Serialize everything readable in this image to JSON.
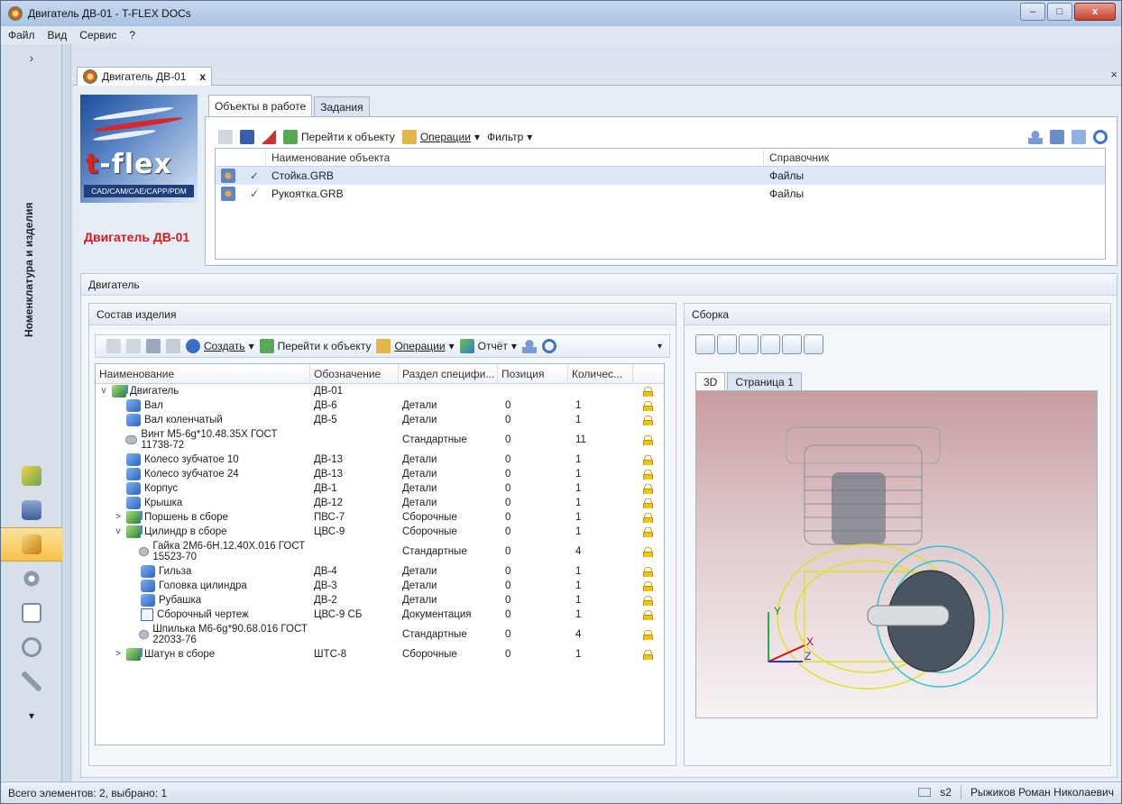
{
  "window": {
    "title": "Двигатель ДВ-01 - T-FLEX DOCs",
    "minimize": "–",
    "maximize": "□",
    "close": "x"
  },
  "menu": [
    "Файл",
    "Вид",
    "Сервис",
    "?"
  ],
  "left_panel": {
    "expander": "›",
    "section_label": "Номенклатура и изделия",
    "more": "▾"
  },
  "doc_tab": {
    "label": "Двигатель ДВ-01",
    "close": "x",
    "close_all": "×"
  },
  "logo": {
    "brand_t": "t",
    "brand_rest": "-flex",
    "subtitle": "CAD/CAM/CAE/CAPP/PDM"
  },
  "product_name": "Двигатель ДВ-01",
  "work_panel": {
    "tabs": [
      "Объекты в работе",
      "Задания"
    ],
    "toolbar": {
      "goto": "Перейти к объекту",
      "operations": "Операции",
      "filter": "Фильтр"
    },
    "columns": [
      "Наименование объекта",
      "Справочник"
    ],
    "rows": [
      {
        "name": "Стойка.GRB",
        "ref": "Файлы"
      },
      {
        "name": "Рукоятка.GRB",
        "ref": "Файлы"
      }
    ]
  },
  "section_title": "Двигатель",
  "composition": {
    "title": "Состав изделия",
    "toolbar": {
      "create": "Создать",
      "goto": "Перейти к объекту",
      "operations": "Операции",
      "report": "Отчёт"
    },
    "columns": [
      "Наименование",
      "Обозначение",
      "Раздел специфи...",
      "Позиция",
      "Количес..."
    ],
    "rows": [
      {
        "level": 0,
        "arrow": "v",
        "icon": "asm",
        "name": "Двигатель",
        "code": "ДВ-01",
        "section": "",
        "pos": "",
        "qty": "",
        "tall": false
      },
      {
        "level": 1,
        "arrow": "",
        "icon": "part",
        "name": "Вал",
        "code": "ДВ-6",
        "section": "Детали",
        "pos": "0",
        "qty": "1",
        "tall": false
      },
      {
        "level": 1,
        "arrow": "",
        "icon": "part",
        "name": "Вал коленчатый",
        "code": "ДВ-5",
        "section": "Детали",
        "pos": "0",
        "qty": "1",
        "tall": false
      },
      {
        "level": 1,
        "arrow": "",
        "icon": "std",
        "name": "Винт М5-6g*10.48.35Х ГОСТ 11738-72",
        "code": "",
        "section": "Стандартные",
        "pos": "0",
        "qty": "11",
        "tall": true
      },
      {
        "level": 1,
        "arrow": "",
        "icon": "part",
        "name": "Колесо зубчатое 10",
        "code": "ДВ-13",
        "section": "Детали",
        "pos": "0",
        "qty": "1",
        "tall": false
      },
      {
        "level": 1,
        "arrow": "",
        "icon": "part",
        "name": "Колесо зубчатое 24",
        "code": "ДВ-13",
        "section": "Детали",
        "pos": "0",
        "qty": "1",
        "tall": false
      },
      {
        "level": 1,
        "arrow": "",
        "icon": "part",
        "name": "Корпус",
        "code": "ДВ-1",
        "section": "Детали",
        "pos": "0",
        "qty": "1",
        "tall": false
      },
      {
        "level": 1,
        "arrow": "",
        "icon": "part",
        "name": "Крышка",
        "code": "ДВ-12",
        "section": "Детали",
        "pos": "0",
        "qty": "1",
        "tall": false
      },
      {
        "level": 1,
        "arrow": ">",
        "icon": "asm",
        "name": "Поршень в сборе",
        "code": "ПВС-7",
        "section": "Сборочные",
        "pos": "0",
        "qty": "1",
        "tall": false
      },
      {
        "level": 1,
        "arrow": "v",
        "icon": "asm",
        "name": "Цилиндр в сборе",
        "code": "ЦВС-9",
        "section": "Сборочные",
        "pos": "0",
        "qty": "1",
        "tall": false
      },
      {
        "level": 2,
        "arrow": "",
        "icon": "std",
        "name": "Гайка 2М6-6Н.12.40Х.016 ГОСТ 15523-70",
        "code": "",
        "section": "Стандартные",
        "pos": "0",
        "qty": "4",
        "tall": true
      },
      {
        "level": 2,
        "arrow": "",
        "icon": "part",
        "name": "Гильза",
        "code": "ДВ-4",
        "section": "Детали",
        "pos": "0",
        "qty": "1",
        "tall": false
      },
      {
        "level": 2,
        "arrow": "",
        "icon": "part",
        "name": "Головка цилиндра",
        "code": "ДВ-3",
        "section": "Детали",
        "pos": "0",
        "qty": "1",
        "tall": false
      },
      {
        "level": 2,
        "arrow": "",
        "icon": "part",
        "name": "Рубашка",
        "code": "ДВ-2",
        "section": "Детали",
        "pos": "0",
        "qty": "1",
        "tall": false
      },
      {
        "level": 2,
        "arrow": "",
        "icon": "doc",
        "name": "Сборочный чертеж",
        "code": "ЦВС-9 СБ",
        "section": "Документация",
        "pos": "0",
        "qty": "1",
        "tall": false
      },
      {
        "level": 2,
        "arrow": "",
        "icon": "std",
        "name": "Шпилька М6-6g*90.68.016 ГОСТ 22033-76",
        "code": "",
        "section": "Стандартные",
        "pos": "0",
        "qty": "4",
        "tall": true
      },
      {
        "level": 1,
        "arrow": ">",
        "icon": "asm",
        "name": "Шатун в сборе",
        "code": "ШТС-8",
        "section": "Сборочные",
        "pos": "0",
        "qty": "1",
        "tall": false
      }
    ]
  },
  "assembly": {
    "title": "Сборка",
    "view_tabs": [
      "3D",
      "Страница 1"
    ],
    "axes": {
      "x": "X",
      "y": "Y",
      "z": "Z"
    }
  },
  "status": {
    "left": "Всего элементов: 2, выбрано: 1",
    "server": "s2",
    "user": "Рыжиков Роман Николаевич"
  },
  "colors": {
    "accent_red": "#d21c1c",
    "selection": "#dce8f7",
    "lock": "#f2c20e"
  }
}
